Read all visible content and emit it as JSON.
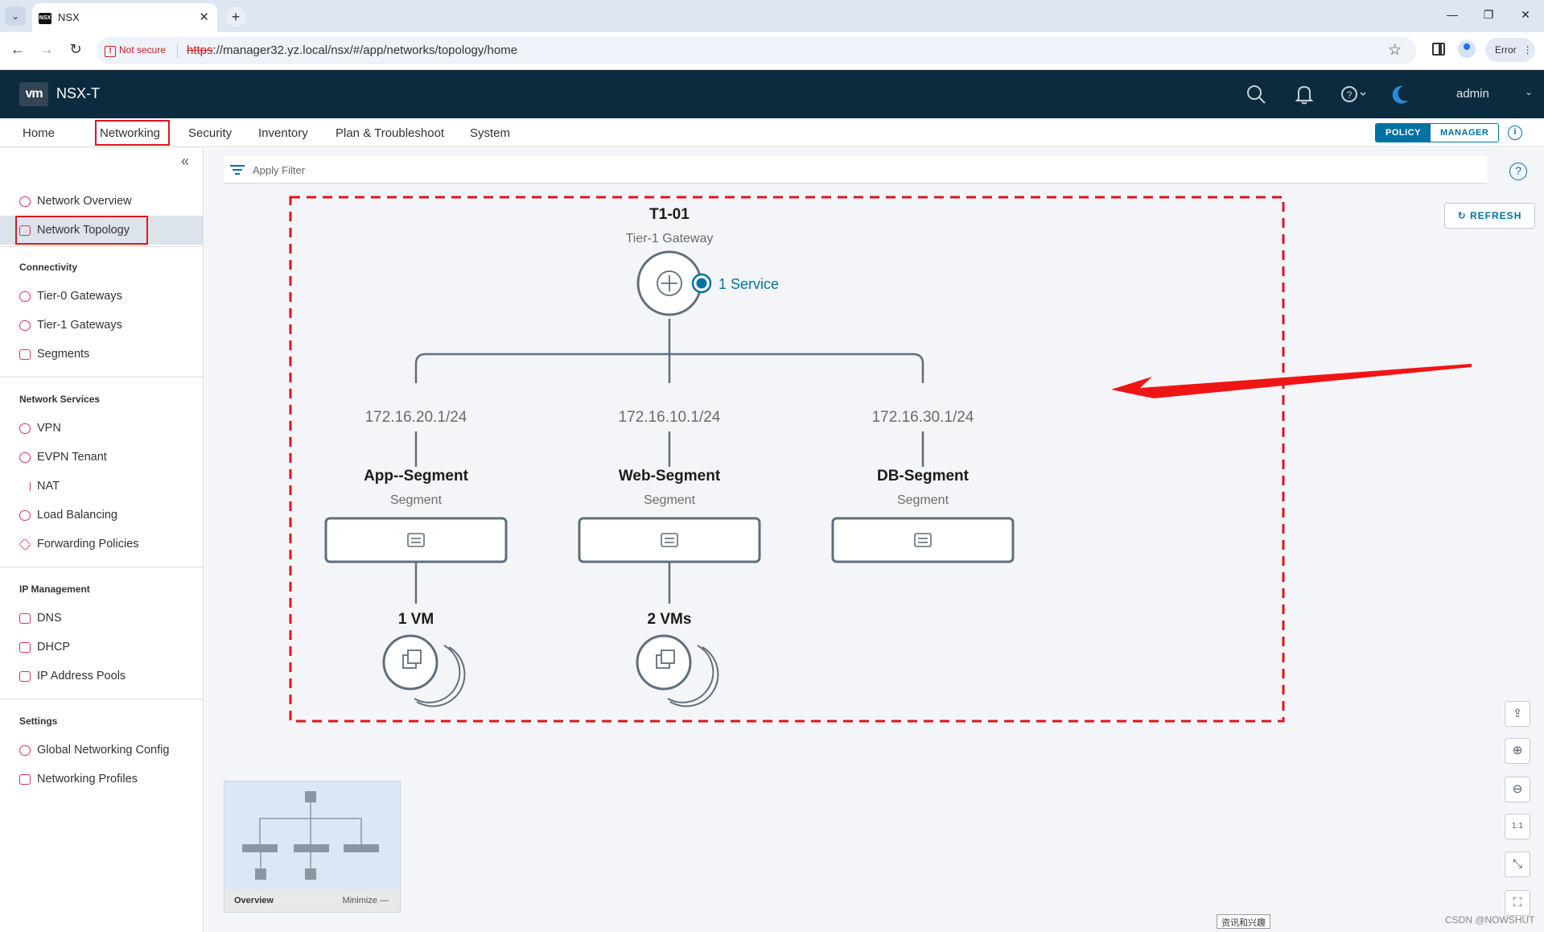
{
  "browser": {
    "tab_title": "NSX",
    "tab_favicon_text": "NSX",
    "security_warning": "Not secure",
    "url_scheme": "https",
    "url_rest": "://manager32.yz.local/nsx/#/app/networks/topology/home",
    "profile_button": "Error"
  },
  "header": {
    "logo": "vm",
    "app_name": "NSX-T",
    "user": "admin"
  },
  "nav": {
    "items": [
      "Home",
      "Networking",
      "Security",
      "Inventory",
      "Plan & Troubleshoot",
      "System"
    ],
    "active": "Networking",
    "mode_policy": "POLICY",
    "mode_manager": "MANAGER",
    "info": "i"
  },
  "sidebar": {
    "top_items": [
      "Network Overview",
      "Network Topology"
    ],
    "active": "Network Topology",
    "sections": [
      {
        "title": "Connectivity",
        "items": [
          "Tier-0 Gateways",
          "Tier-1 Gateways",
          "Segments"
        ]
      },
      {
        "title": "Network Services",
        "items": [
          "VPN",
          "EVPN Tenant",
          "NAT",
          "Load Balancing",
          "Forwarding Policies"
        ]
      },
      {
        "title": "IP Management",
        "items": [
          "DNS",
          "DHCP",
          "IP Address Pools"
        ]
      },
      {
        "title": "Settings",
        "items": [
          "Global Networking Config",
          "Networking Profiles"
        ]
      }
    ]
  },
  "main": {
    "filter_placeholder": "Apply Filter",
    "help": "?",
    "refresh_label": "REFRESH"
  },
  "topology": {
    "gateway": {
      "name": "T1-01",
      "type": "Tier-1 Gateway",
      "services": "1 Service"
    },
    "segments": [
      {
        "name": "App--Segment",
        "type": "Segment",
        "gateway_ip": "172.16.20.1/24",
        "vms": "1 VM"
      },
      {
        "name": "Web-Segment",
        "type": "Segment",
        "gateway_ip": "172.16.10.1/24",
        "vms": "2 VMs"
      },
      {
        "name": "DB-Segment",
        "type": "Segment",
        "gateway_ip": "172.16.30.1/24",
        "vms": ""
      }
    ],
    "colors": {
      "line": "#5f6f7c",
      "highlight_box": "#e0141e",
      "arrow": "#f01515",
      "service_dot": "#0072a3"
    }
  },
  "overview": {
    "title": "Overview",
    "minimize": "Minimize"
  },
  "footer": {
    "tooltip": "资讯和兴趣",
    "watermark": "CSDN @NOWSHUT"
  }
}
